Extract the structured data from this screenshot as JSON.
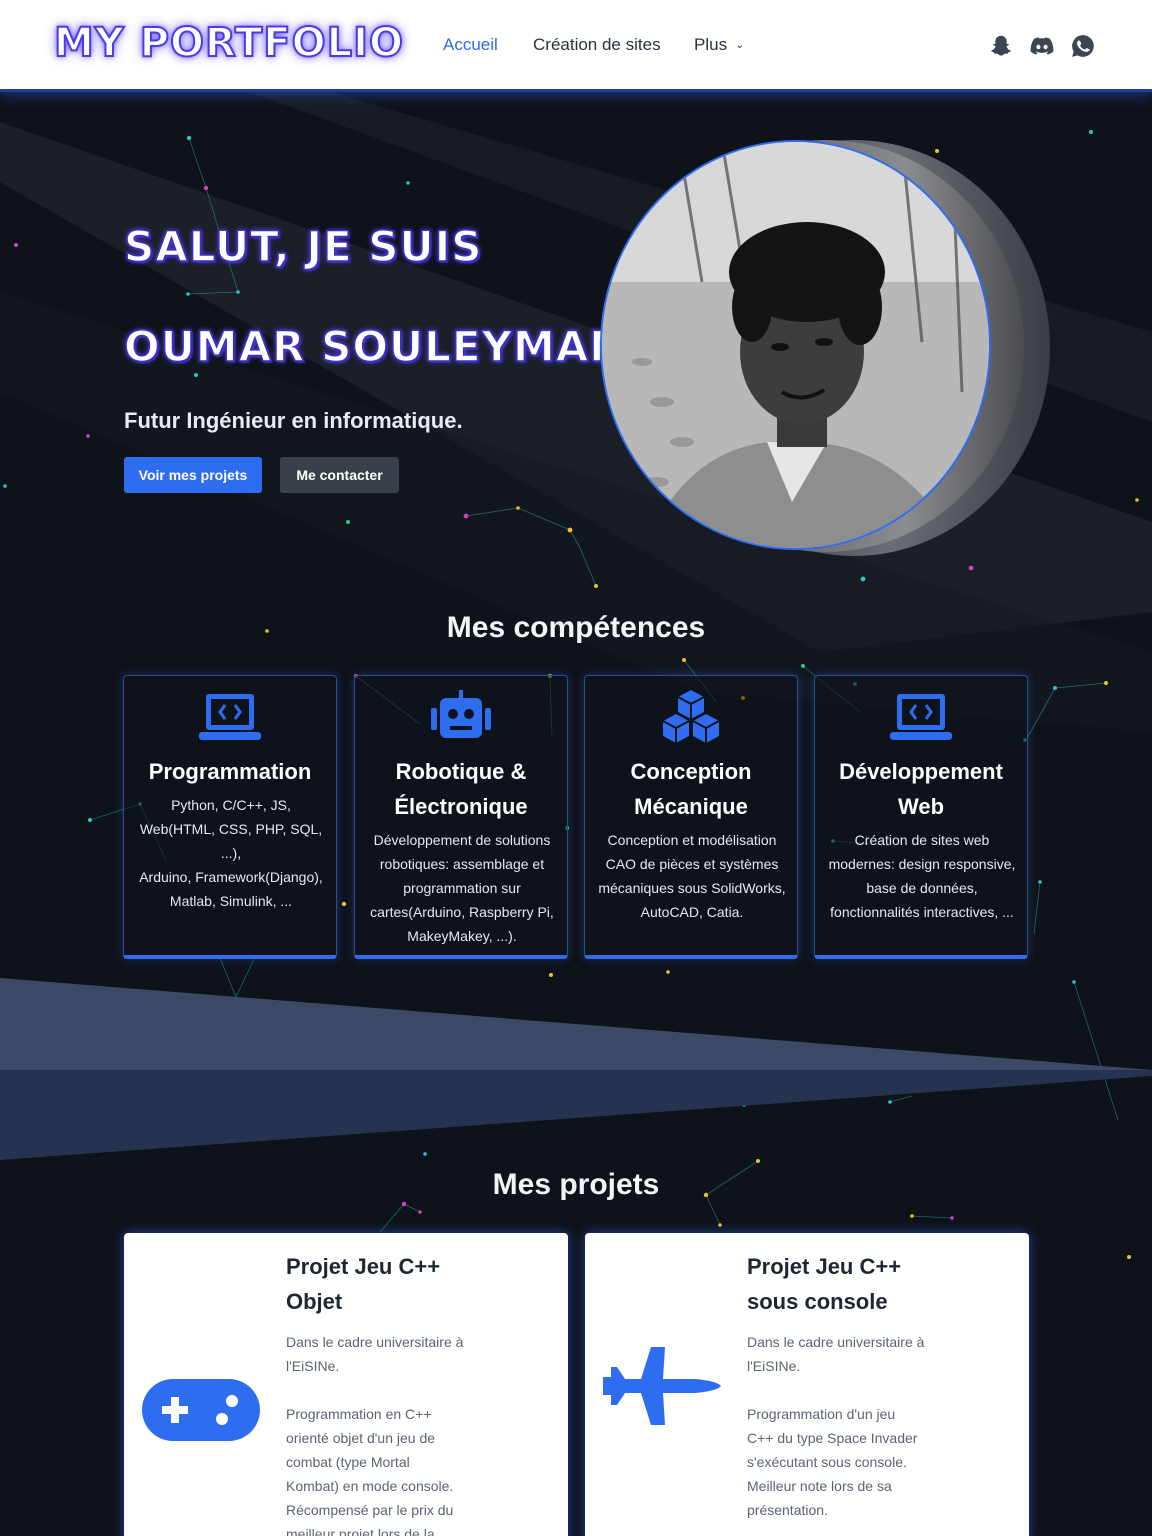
{
  "header": {
    "logo": "MY PORTFOLIO",
    "nav": [
      {
        "label": "Accueil",
        "active": true
      },
      {
        "label": "Création de sites",
        "active": false
      },
      {
        "label": "Plus",
        "active": false
      }
    ],
    "social_icons": [
      "snapchat-icon",
      "discord-icon",
      "whatsapp-icon"
    ]
  },
  "hero": {
    "line1": "SALUT, JE SUIS",
    "line2": "OUMAR SOULEYMAN",
    "subtitle": "Futur Ingénieur en informatique.",
    "btn_projects": "Voir mes projets",
    "btn_contact": "Me contacter"
  },
  "skills": {
    "title": "Mes compétences",
    "items": [
      {
        "icon": "laptop-code-icon",
        "title": "Programmation",
        "lines": [
          "Python, C/C++, JS,",
          "Web(HTML, CSS, PHP, SQL,",
          "...),",
          "Arduino, Framework(Django),",
          "Matlab, Simulink, ..."
        ]
      },
      {
        "icon": "robot-icon",
        "title_lines": [
          "Robotique &",
          "Électronique"
        ],
        "lines": [
          "Développement de solutions",
          "robotiques: assemblage et",
          "programmation sur",
          "cartes(Arduino, Raspberry Pi,",
          "MakeyMakey, ...)."
        ]
      },
      {
        "icon": "cubes-icon",
        "title_lines": [
          "Conception",
          "Mécanique"
        ],
        "lines": [
          "Conception et modélisation",
          "CAO de pièces et systèmes",
          "mécaniques sous SolidWorks,",
          "AutoCAD, Catia."
        ]
      },
      {
        "icon": "laptop-code-icon",
        "title_lines": [
          "Développement",
          "Web"
        ],
        "lines": [
          "Création de sites web",
          "modernes: design responsive,",
          "base de données,",
          "fonctionnalités interactives, ..."
        ]
      }
    ]
  },
  "projects": {
    "title": "Mes projets",
    "items": [
      {
        "icon": "gamepad-icon",
        "title_lines": [
          "Projet Jeu C++",
          "Objet"
        ],
        "p1": [
          "Dans le cadre universitaire à",
          "l'EiSINe."
        ],
        "p2": [
          "Programmation en C++",
          "orienté objet d'un jeu de",
          "combat (type Mortal",
          "Kombat) en mode console.",
          "Récompensé par le prix du",
          "meilleur projet lors de la"
        ]
      },
      {
        "icon": "fighter-jet-icon",
        "title_lines": [
          "Projet Jeu C++",
          "sous console"
        ],
        "p1": [
          "Dans le cadre universitaire à",
          "l'EiSINe."
        ],
        "p2": [
          "Programmation d'un jeu",
          "C++ du type Space Invader",
          "s'exécutant sous console.",
          "Meilleur note lors de sa",
          "présentation."
        ]
      }
    ]
  },
  "colors": {
    "accent": "#2f6df0",
    "background": "#0e1219",
    "header_bg": "#ffffff"
  }
}
